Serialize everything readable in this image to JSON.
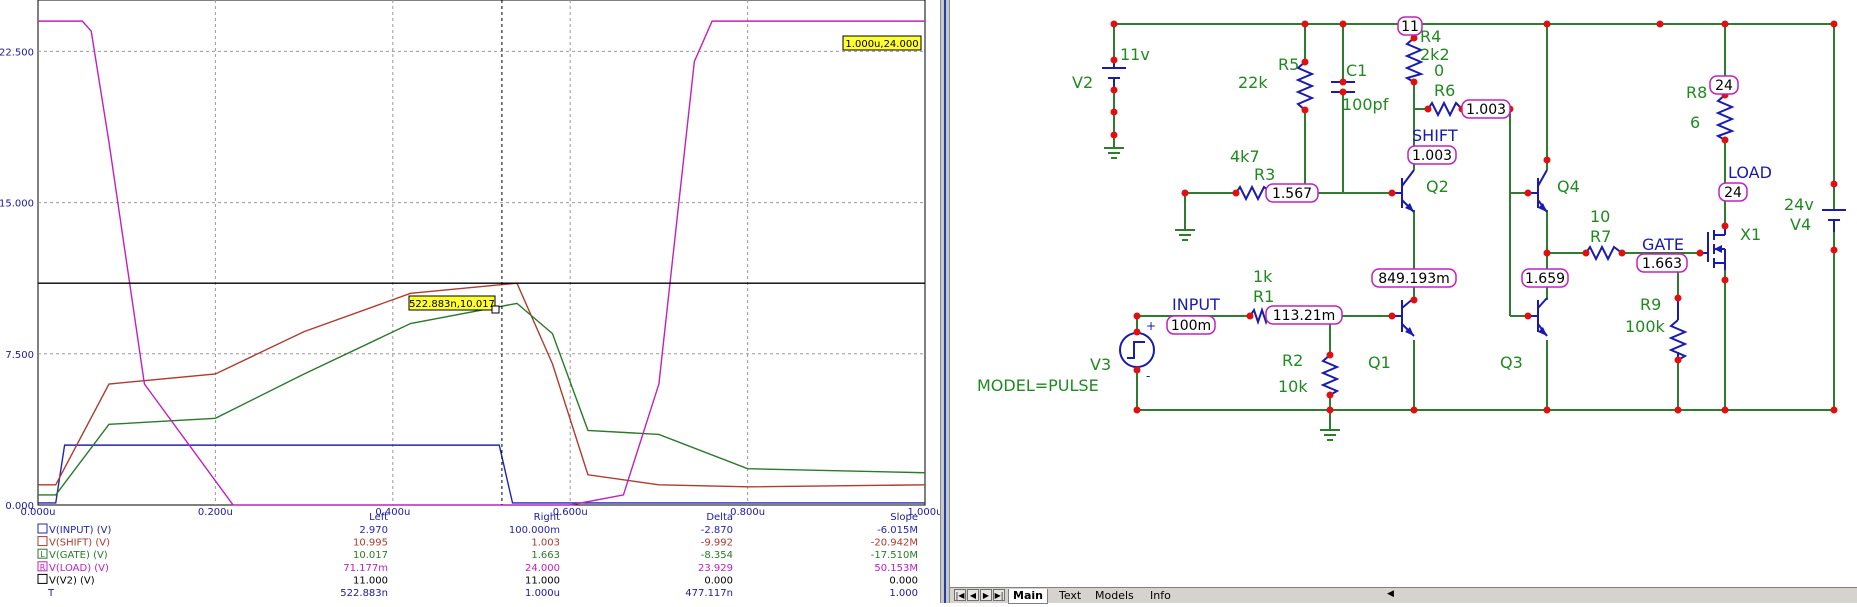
{
  "chart_data": {
    "type": "line",
    "ylim": [
      0,
      24.75
    ],
    "xlim": [
      0,
      1.0
    ],
    "y_ticks": [
      "0.000",
      "7.500",
      "15.000",
      "22.500"
    ],
    "y_tick_values": [
      0,
      7.5,
      15,
      22.5
    ],
    "x_ticks": [
      "0.000u",
      "0.200u",
      "0.400u",
      "0.600u",
      "0.800u",
      "1.000u"
    ],
    "x_tick_values": [
      0,
      0.2,
      0.4,
      0.6,
      0.8,
      1.0
    ],
    "grid": true,
    "cursor_x": 0.523,
    "hline_y": 11.0,
    "series": [
      {
        "name": "V(INPUT) (V)",
        "color": "#2424b0",
        "x": [
          0,
          0.02,
          0.03,
          0.52,
          0.535,
          1.0
        ],
        "y": [
          0.1,
          0.1,
          2.97,
          2.97,
          0.1,
          0.1
        ]
      },
      {
        "name": "V(SHIFT) (V)",
        "color": "#b03a2e",
        "x": [
          0,
          0.02,
          0.08,
          0.2,
          0.3,
          0.42,
          0.54,
          0.58,
          0.62,
          0.7,
          0.8,
          1.0
        ],
        "y": [
          1.0,
          1.0,
          6.0,
          6.5,
          8.6,
          10.5,
          11.0,
          7.0,
          1.5,
          1.0,
          0.9,
          1.0
        ]
      },
      {
        "name": "V(GATE) (V)",
        "color": "#2a7a2a",
        "x": [
          0,
          0.02,
          0.08,
          0.2,
          0.3,
          0.42,
          0.54,
          0.58,
          0.62,
          0.7,
          0.8,
          1.0
        ],
        "y": [
          0.5,
          0.5,
          4.0,
          4.3,
          6.5,
          9.0,
          10.0,
          8.5,
          3.7,
          3.5,
          1.8,
          1.6
        ]
      },
      {
        "name": "V(LOAD) (V)",
        "color": "#c020c0",
        "x": [
          0,
          0.05,
          0.06,
          0.08,
          0.12,
          0.22,
          0.6,
          0.66,
          0.7,
          0.74,
          0.76,
          1.0
        ],
        "y": [
          24.0,
          24.0,
          23.5,
          18.0,
          6.0,
          0.0,
          0.0,
          0.5,
          6.0,
          22.0,
          24.0,
          24.0
        ]
      },
      {
        "name": "V(V2) (V)",
        "color": "#000000",
        "x": [
          0,
          1.0
        ],
        "y": [
          11.0,
          11.0
        ]
      }
    ]
  },
  "plot": {
    "label_top_right": "1.000u,24.000",
    "label_cursor": "522.883n,10.017",
    "table": {
      "headers": [
        "Left",
        "Right",
        "Delta",
        "Slope"
      ],
      "rows": [
        {
          "marker": "",
          "name": "V(INPUT) (V)",
          "left": "2.970",
          "right": "100.000m",
          "delta": "-2.870",
          "slope": "-6.015M",
          "color": "#2424b0"
        },
        {
          "marker": "",
          "name": "V(SHIFT) (V)",
          "left": "10.995",
          "right": "1.003",
          "delta": "-9.992",
          "slope": "-20.942M",
          "color": "#b03a2e"
        },
        {
          "marker": "L",
          "name": "V(GATE) (V)",
          "left": "10.017",
          "right": "1.663",
          "delta": "-8.354",
          "slope": "-17.510M",
          "color": "#2a7a2a"
        },
        {
          "marker": "R",
          "name": "V(LOAD) (V)",
          "left": "71.177m",
          "right": "24.000",
          "delta": "23.929",
          "slope": "50.153M",
          "color": "#c020c0"
        },
        {
          "marker": "",
          "name": "V(V2) (V)",
          "left": "11.000",
          "right": "11.000",
          "delta": "0.000",
          "slope": "0.000",
          "color": "#000000"
        },
        {
          "marker": "",
          "name": "T",
          "left": "522.883n",
          "right": "1.000u",
          "delta": "477.117n",
          "slope": "1.000",
          "color": "#1a1aa0"
        }
      ]
    }
  },
  "schematic": {
    "V2": "V2",
    "V2_val": "11v",
    "R5": "R5",
    "R5_val": "22k",
    "C1": "C1",
    "C1_val": "100pf",
    "R4": "R4",
    "R4_val": "2k2",
    "R4_node": "11",
    "R6": "R6",
    "R6_val": "0",
    "R6_node": "1.003",
    "SHIFT": "SHIFT",
    "SHIFT_node": "1.003",
    "R3": "R3",
    "R3_val": "4k7",
    "R3_node": "1.567",
    "Q2": "Q2",
    "Q4": "Q4",
    "Q1": "Q1",
    "Q3": "Q3",
    "R8": "R8",
    "R8_val": "6",
    "R8_node": "24",
    "LOAD": "LOAD",
    "LOAD_node": "24",
    "R7": "R7",
    "R7_val": "10",
    "GATE": "GATE",
    "GATE_node": "1.663",
    "X1": "X1",
    "V4": "V4",
    "V4_val": "24v",
    "Q1_node": "849.193m",
    "Q3_node": "1.659",
    "R1": "R1",
    "R1_val": "1k",
    "R1_node": "113.21m",
    "INPUT": "INPUT",
    "INPUT_node": "100m",
    "R2": "R2",
    "R2_val": "10k",
    "R9": "R9",
    "R9_val": "100k",
    "V3": "V3",
    "MODEL": "MODEL=PULSE",
    "plus": "+",
    "minus": "-"
  },
  "tabs": {
    "items": [
      "Main",
      "Text",
      "Models",
      "Info"
    ],
    "active": "Main"
  }
}
